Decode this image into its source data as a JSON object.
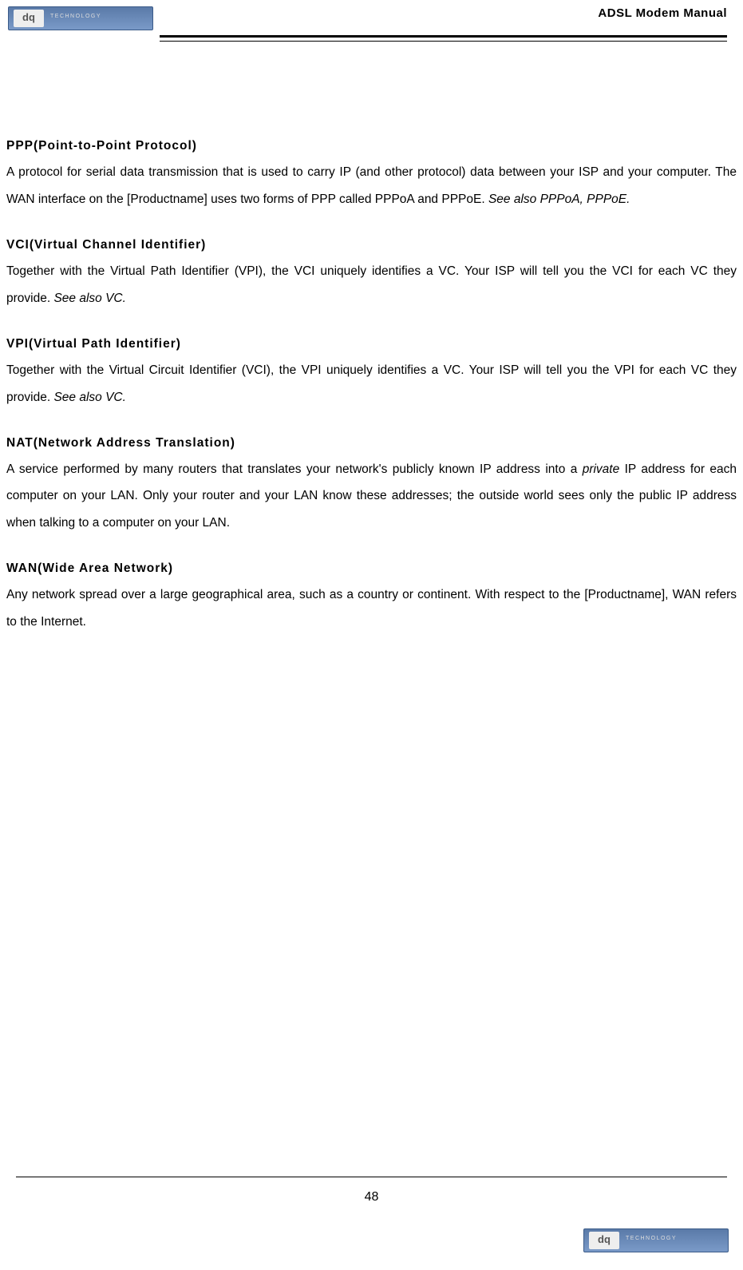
{
  "header": {
    "title": "ADSL Modem Manual",
    "logo_brand": "dq",
    "logo_subtext": "TECHNOLOGY"
  },
  "glossary": [
    {
      "term": "PPP(Point-to-Point Protocol)",
      "definition_pre": "A protocol for serial data transmission that is used to carry IP (and other protocol) data between your ISP and your computer. The WAN interface on the [Productname] uses two forms of PPP called PPPoA and PPPoE. ",
      "definition_italic": "See also PPPoA, PPPoE.",
      "definition_post": ""
    },
    {
      "term": "VCI(Virtual Channel Identifier)",
      "definition_pre": "Together with the Virtual Path Identifier (VPI), the VCI uniquely identifies a VC. Your ISP will tell you the VCI for each VC they provide. ",
      "definition_italic": "See also VC.",
      "definition_post": ""
    },
    {
      "term": "VPI(Virtual Path Identifier)",
      "definition_pre": "Together with the Virtual Circuit Identifier (VCI), the VPI uniquely identifies a VC. Your ISP will tell you the VPI for each VC they provide. ",
      "definition_italic": "See also VC.",
      "definition_post": ""
    },
    {
      "term": "NAT(Network Address Translation)",
      "definition_pre": "A service performed by many routers that translates your network's publicly known IP address into a ",
      "definition_italic": "private",
      "definition_post": " IP address for each computer on your LAN. Only your router and your LAN know these addresses; the outside world sees only the public IP address when talking to a computer on your LAN."
    },
    {
      "term": "WAN(Wide Area Network)",
      "definition_pre": "Any network spread over a large geographical area, such as a country or continent. With respect to the [Productname], WAN refers to the Internet.",
      "definition_italic": "",
      "definition_post": ""
    }
  ],
  "footer": {
    "page_number": "48"
  }
}
